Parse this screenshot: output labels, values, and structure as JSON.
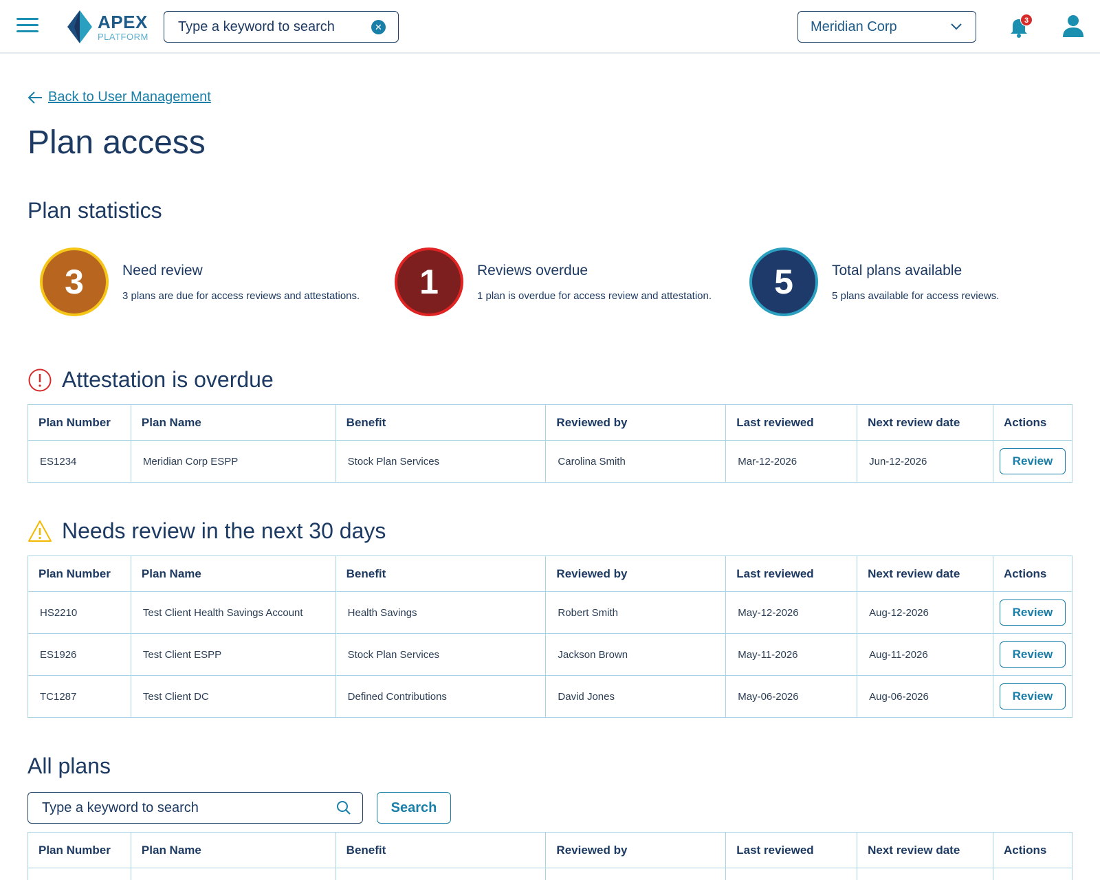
{
  "header": {
    "logo_title": "APEX",
    "logo_subtitle": "PLATFORM",
    "search_placeholder": "Type a keyword to search",
    "company": "Meridian Corp",
    "notification_count": "3",
    "icons": [
      "menu-icon",
      "clear-icon",
      "chevron-down-icon",
      "bell-icon",
      "user-icon"
    ]
  },
  "nav": {
    "back_label": "Back to User Management"
  },
  "page": {
    "title": "Plan access"
  },
  "stats": {
    "title": "Plan statistics",
    "items": [
      {
        "value": "3",
        "label": "Need review",
        "desc": "3 plans are due for access reviews and attestations.",
        "color": "#b8651f",
        "ring": "#f5c518"
      },
      {
        "value": "1",
        "label": "Reviews overdue",
        "desc": "1 plan is overdue for access review and attestation.",
        "color": "#7e1f1f",
        "ring": "#e02424"
      },
      {
        "value": "5",
        "label": "Total plans available",
        "desc": "5 plans available for access reviews.",
        "color": "#1e3a6a",
        "ring": "#2a9fc0"
      }
    ]
  },
  "columns": [
    "Plan Number",
    "Plan Name",
    "Benefit",
    "Reviewed by",
    "Last reviewed",
    "Next review date",
    "Actions"
  ],
  "review_label": "Review",
  "overdue": {
    "title": "Attestation is overdue",
    "rows": [
      [
        "ES1234",
        "Meridian Corp ESPP",
        "Stock Plan Services",
        "Carolina Smith",
        "Mar-12-2026",
        "Jun-12-2026"
      ]
    ]
  },
  "upcoming": {
    "title": "Needs review in the next 30 days",
    "rows": [
      [
        "HS2210",
        "Test Client Health Savings Account",
        "Health Savings",
        "Robert Smith",
        "May-12-2026",
        "Aug-12-2026"
      ],
      [
        "ES1926",
        "Test Client ESPP",
        "Stock Plan Services",
        "Jackson Brown",
        "May-11-2026",
        "Aug-11-2026"
      ],
      [
        "TC1287",
        "Test Client DC",
        "Defined Contributions",
        "David Jones",
        "May-06-2026",
        "Aug-06-2026"
      ]
    ]
  },
  "all_plans": {
    "title": "All plans",
    "search_placeholder": "Type a keyword to search",
    "search_button": "Search"
  },
  "colors": {
    "accent": "#1a7fa8",
    "navy": "#1d3a63",
    "border": "#a8d3e3",
    "danger": "#d52b2b",
    "warning": "#f5b800"
  }
}
